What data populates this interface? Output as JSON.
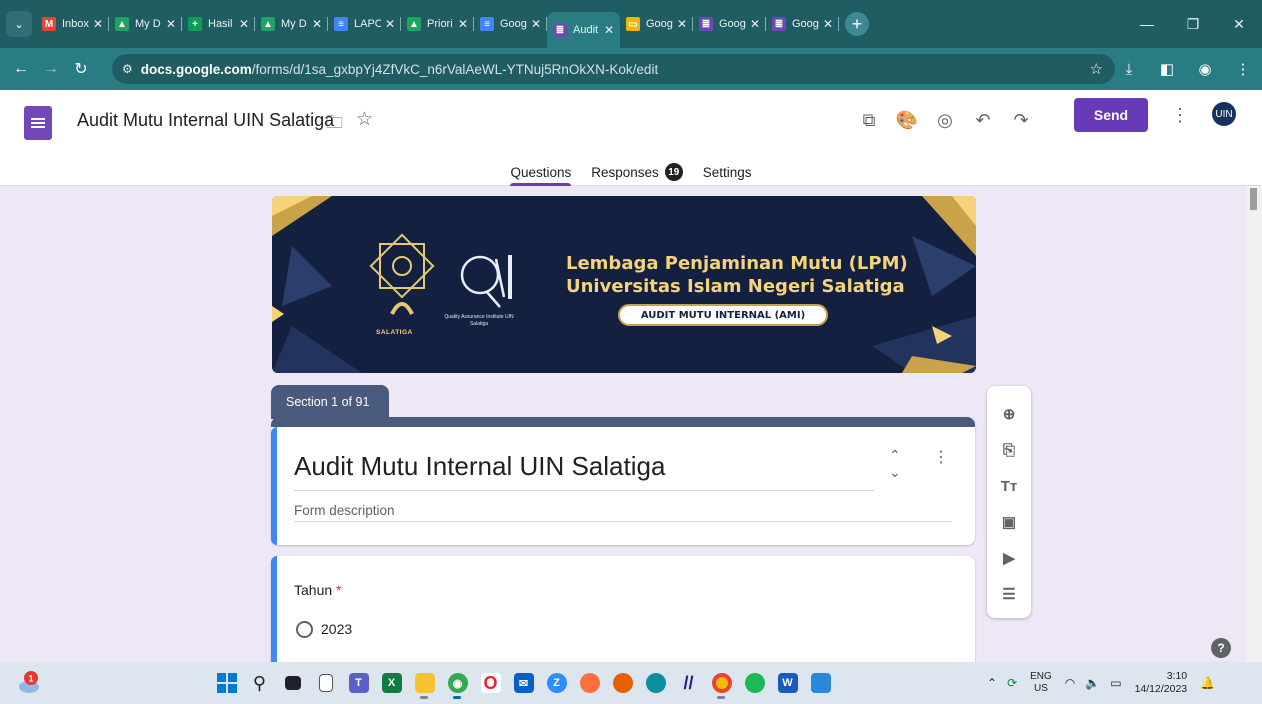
{
  "browser": {
    "tabs": [
      {
        "label": "Inbox",
        "icon": "gmail-icon",
        "color": "#ea4335",
        "glyph": "M"
      },
      {
        "label": "My D",
        "icon": "drive-icon",
        "color": "#1fa463",
        "glyph": "▲"
      },
      {
        "label": "Hasil",
        "icon": "sheets-icon",
        "color": "#0f9d58",
        "glyph": "+"
      },
      {
        "label": "My D",
        "icon": "drive-icon",
        "color": "#1fa463",
        "glyph": "▲"
      },
      {
        "label": "LAPO",
        "icon": "docs-icon",
        "color": "#4285f4",
        "glyph": "≡"
      },
      {
        "label": "Priori",
        "icon": "drive-icon",
        "color": "#1fa463",
        "glyph": "▲"
      },
      {
        "label": "Goog",
        "icon": "docs-icon",
        "color": "#4285f4",
        "glyph": "≡"
      },
      {
        "label": "Audit",
        "icon": "forms-icon",
        "color": "#7248b9",
        "glyph": "≣",
        "active": true
      },
      {
        "label": "Goog",
        "icon": "slides-icon",
        "color": "#f4b400",
        "glyph": "▭"
      },
      {
        "label": "Goog",
        "icon": "forms-icon",
        "color": "#7248b9",
        "glyph": "≣"
      },
      {
        "label": "Goog",
        "icon": "forms-icon",
        "color": "#7248b9",
        "glyph": "≣"
      }
    ],
    "url_domain": "docs.google.com",
    "url_path": "/forms/d/1sa_gxbpYj4ZfVkC_n6rValAeWL-YTNuj5RnOkXN-Kok/edit"
  },
  "form": {
    "doc_title": "Audit Mutu Internal UIN Salatiga",
    "send_label": "Send",
    "tabs": {
      "questions": "Questions",
      "responses": "Responses",
      "responses_count": "19",
      "settings": "Settings"
    },
    "banner": {
      "line1": "Lembaga Penjaminan Mutu (LPM)",
      "line2": "Universitas Islam Negeri Salatiga",
      "pill": "AUDIT MUTU INTERNAL (AMI)",
      "logo_text": "SALATIGA",
      "qai_caption": "Quality Assurance Institute UIN Salatiga"
    },
    "section_label": "Section 1 of 91",
    "title": "Audit Mutu Internal UIN Salatiga",
    "description_placeholder": "Form description",
    "question": {
      "title": "Tahun",
      "required_mark": "*",
      "options": [
        "2023"
      ]
    }
  },
  "taskbar": {
    "lang_line1": "ENG",
    "lang_line2": "US",
    "time": "3:10",
    "date": "14/12/2023",
    "weather_badge": "1"
  },
  "colors": {
    "accent": "#673ab7",
    "tabstrip": "#1f5d63",
    "toolbar": "#2a7c83",
    "section": "#4a5a7d",
    "focus_bar": "#4285f4"
  }
}
